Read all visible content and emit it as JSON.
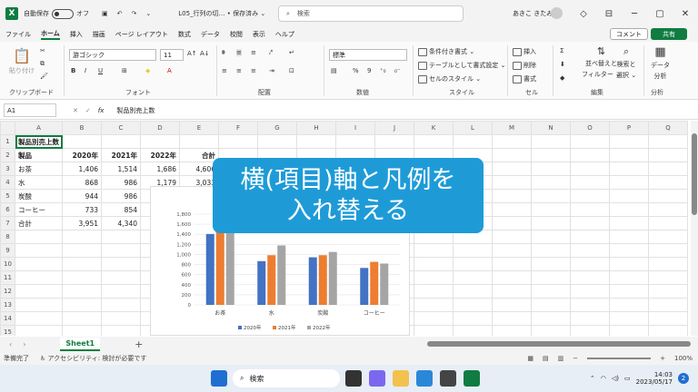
{
  "titlebar": {
    "autosave": "自動保存",
    "autosave_state": "オフ",
    "filename": "L05_行列の切… • 保存済み ⌄",
    "search_placeholder": "検索",
    "user": "あきこ きたみ"
  },
  "menu": [
    "ファイル",
    "ホーム",
    "挿入",
    "描画",
    "ページ レイアウト",
    "数式",
    "データ",
    "校閲",
    "表示",
    "ヘルプ"
  ],
  "menu_active": "ホーム",
  "ribbon": {
    "comment": "コメント",
    "share": "共有",
    "paste": "貼り付け",
    "clipboard": "クリップボード",
    "font_name": "游ゴシック",
    "font_size": "11",
    "font_group": "フォント",
    "align_group": "配置",
    "number_format": "標準",
    "number_group": "数値",
    "cond_format": "条件付き書式 ⌄",
    "table_format": "テーブルとして書式設定 ⌄",
    "cell_style": "セルのスタイル ⌄",
    "style_group": "スタイル",
    "insert": "挿入",
    "delete": "削除",
    "format": "書式",
    "cells_group": "セル",
    "sort": "並べ替えと",
    "sort2": "フィルター ⌄",
    "find": "検索と",
    "find2": "選択 ⌄",
    "edit_group": "編集",
    "analyze": "データ",
    "analyze2": "分析",
    "analyze_group": "分析"
  },
  "formula": {
    "namebox": "A1",
    "fx": "fx",
    "value": "製品別売上数"
  },
  "columns": [
    "A",
    "B",
    "C",
    "D",
    "E",
    "F",
    "G",
    "H",
    "I",
    "J",
    "K",
    "L",
    "M",
    "N",
    "O",
    "P",
    "Q"
  ],
  "rows": [
    [
      "製品別売上数",
      "",
      "",
      "",
      ""
    ],
    [
      "製品",
      "2020年",
      "2021年",
      "2022年",
      "合計"
    ],
    [
      "お茶",
      "1,406",
      "1,514",
      "1,686",
      "4,606"
    ],
    [
      "水",
      "868",
      "986",
      "1,179",
      "3,033"
    ],
    [
      "炭酸",
      "944",
      "986",
      "",
      ""
    ],
    [
      "コーヒー",
      "733",
      "854",
      "",
      ""
    ],
    [
      "合計",
      "3,951",
      "4,340",
      "",
      ""
    ],
    [
      "",
      "",
      "",
      "",
      ""
    ],
    [
      "",
      "",
      "",
      "",
      ""
    ],
    [
      "",
      "",
      "",
      "",
      ""
    ],
    [
      "",
      "",
      "",
      "",
      ""
    ],
    [
      "",
      "",
      "",
      "",
      ""
    ],
    [
      "",
      "",
      "",
      "",
      ""
    ],
    [
      "",
      "",
      "",
      "",
      ""
    ],
    [
      "",
      "",
      "",
      "",
      ""
    ]
  ],
  "overlay": {
    "line1": "横(項目)軸と凡例を",
    "line2": "入れ替える"
  },
  "chart_data": {
    "type": "bar",
    "categories": [
      "お茶",
      "水",
      "炭酸",
      "コーヒー"
    ],
    "series": [
      {
        "name": "2020年",
        "values": [
          1406,
          868,
          944,
          733
        ],
        "color": "#4472c4"
      },
      {
        "name": "2021年",
        "values": [
          1514,
          986,
          986,
          854
        ],
        "color": "#ed7d31"
      },
      {
        "name": "2022年",
        "values": [
          1686,
          1179,
          1050,
          820
        ],
        "color": "#a5a5a5"
      }
    ],
    "yticks": [
      "0",
      "200",
      "400",
      "600",
      "800",
      "1,000",
      "1,200",
      "1,400",
      "1,600",
      "1,800"
    ],
    "ylim": [
      0,
      1800
    ],
    "legend": "bottom"
  },
  "sheet_tab": "Sheet1",
  "status": {
    "ready": "準備完了",
    "accessibility": "アクセシビリティ: 検討が必要です",
    "zoom": "100%"
  },
  "taskbar": {
    "search": "検索",
    "time": "14:03",
    "date": "2023/05/17",
    "badge": "2"
  }
}
